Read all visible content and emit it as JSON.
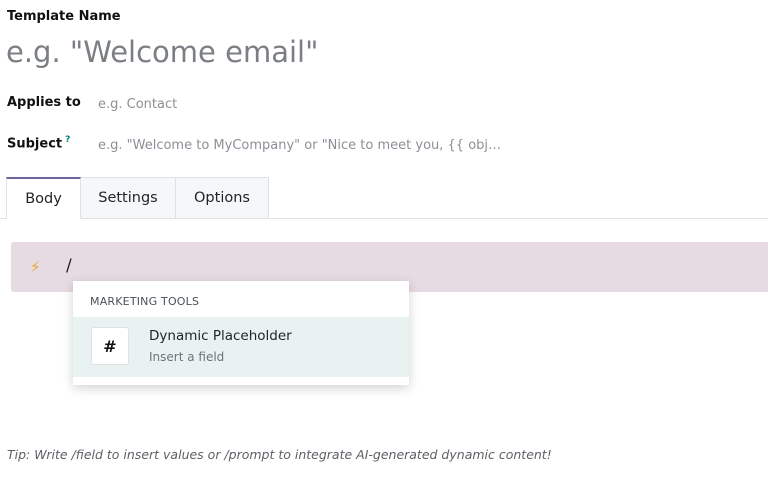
{
  "form": {
    "template_name_label": "Template Name",
    "template_name_placeholder": "e.g. \"Welcome email\"",
    "applies_to_label": "Applies to",
    "applies_to_placeholder": "e.g. Contact",
    "subject_label": "Subject",
    "subject_help_mark": "?",
    "subject_placeholder": "e.g. \"Welcome to MyCompany\" or \"Nice to meet you, {{ obj…"
  },
  "tabs": [
    {
      "label": "Body",
      "active": true
    },
    {
      "label": "Settings",
      "active": false
    },
    {
      "label": "Options",
      "active": false
    }
  ],
  "editor": {
    "icon": "lightning-bolt-icon",
    "typed_text": "/"
  },
  "command_dropdown": {
    "section_header": "MARKETING TOOLS",
    "items": [
      {
        "icon_glyph": "#",
        "title": "Dynamic Placeholder",
        "description": "Insert a field"
      }
    ]
  },
  "tip": "Tip: Write /field to insert values or /prompt to integrate AI-generated dynamic content!",
  "colors": {
    "accent": "#71639e",
    "editor_highlight": "#e6dbe2",
    "dropdown_item_highlight": "#e8f2f1",
    "help_mark": "#017e84",
    "bolt": "#f0a72a"
  }
}
